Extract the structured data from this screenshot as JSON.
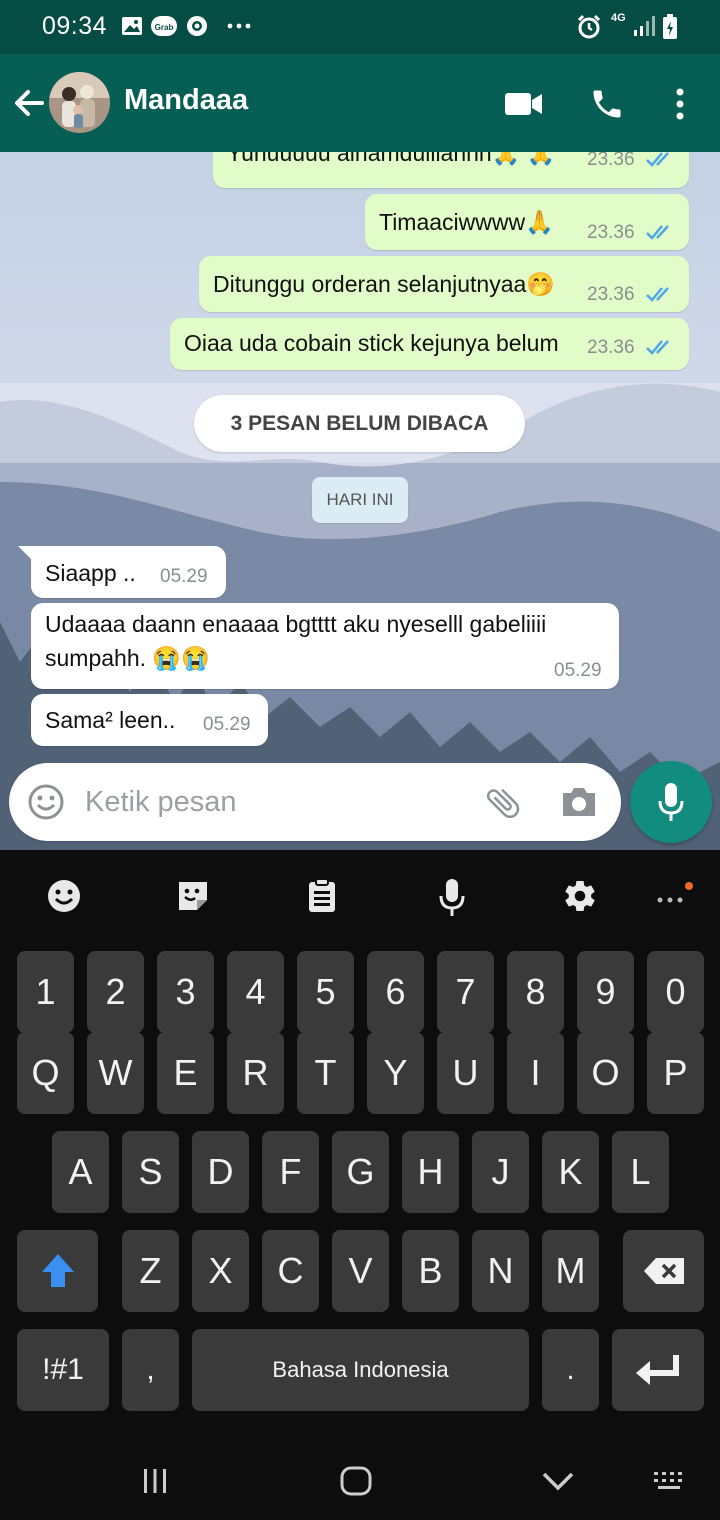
{
  "status_bar": {
    "time": "09:34",
    "network": "4G",
    "left_icons": [
      "image-icon",
      "grab-icon",
      "circle-app-icon",
      "more-notifications-icon"
    ],
    "right_icons": [
      "alarm-icon",
      "signal-icon",
      "battery-icon"
    ]
  },
  "header": {
    "contact_name": "Mandaaa",
    "actions": [
      "video-call-icon",
      "voice-call-icon",
      "overflow-menu-icon"
    ]
  },
  "messages": [
    {
      "direction": "outgoing",
      "text": "Yuhuuuuu alhamdulilahhh🙏 🙏",
      "time": "23.36",
      "status": "read"
    },
    {
      "direction": "outgoing",
      "text": "Timaaciwwww🙏",
      "time": "23.36",
      "status": "read"
    },
    {
      "direction": "outgoing",
      "text": "Ditunggu orderan selanjutnyaa🤭",
      "time": "23.36",
      "status": "read"
    },
    {
      "direction": "outgoing",
      "text": "Oiaa uda cobain stick kejunya belum",
      "time": "23.36",
      "status": "read"
    },
    {
      "direction": "incoming",
      "text": "Siaapp ..",
      "time": "05.29"
    },
    {
      "direction": "incoming",
      "text": "Udaaaa daann enaaaa bgtttt aku nyeselll gabeliiii",
      "text_line2": "sumpahh. 😭😭",
      "time": "05.29"
    },
    {
      "direction": "incoming",
      "text": "Sama² leen..",
      "time": "05.29"
    }
  ],
  "unread_banner": "3 PESAN BELUM DIBACA",
  "date_divider": "HARI INI",
  "composer": {
    "placeholder": "Ketik pesan",
    "value": ""
  },
  "keyboard": {
    "toolbar": [
      "emoji-icon",
      "sticker-icon",
      "clipboard-icon",
      "voice-input-icon",
      "settings-icon",
      "more-options-icon"
    ],
    "number_row": [
      "1",
      "2",
      "3",
      "4",
      "5",
      "6",
      "7",
      "8",
      "9",
      "0"
    ],
    "row1": [
      "Q",
      "W",
      "E",
      "R",
      "T",
      "Y",
      "U",
      "I",
      "O",
      "P"
    ],
    "row2": [
      "A",
      "S",
      "D",
      "F",
      "G",
      "H",
      "J",
      "K",
      "L"
    ],
    "row3": [
      "Z",
      "X",
      "C",
      "V",
      "B",
      "N",
      "M"
    ],
    "symbols_key": "!#1",
    "comma_key": ",",
    "space_label": "Bahasa Indonesia",
    "period_key": "."
  },
  "colors": {
    "header": "#075e54",
    "status_bar": "#054d44",
    "outgoing_bubble": "#e1fcc8",
    "incoming_bubble": "#ffffff",
    "read_ticks": "#4fa6e8",
    "fab": "#128c7e",
    "shift_active": "#3b8ff0"
  }
}
